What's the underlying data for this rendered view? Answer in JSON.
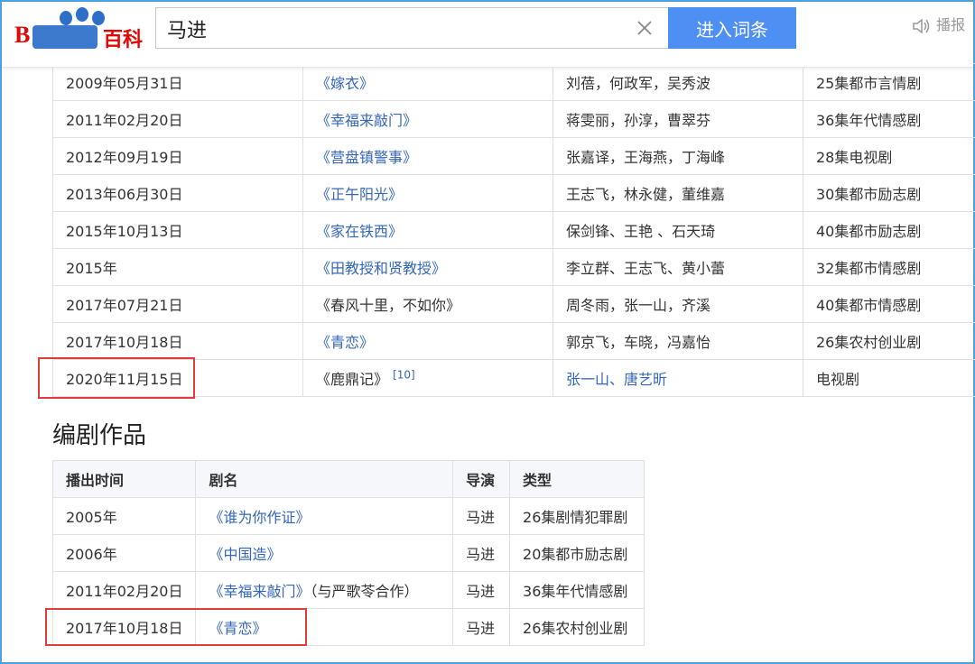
{
  "header": {
    "logo_text": "Bai百科",
    "search_value": "马进",
    "search_placeholder": "",
    "enter_button": "进入词条",
    "broadcast_label": "播报",
    "icons": [
      "clear-icon",
      "speaker-icon"
    ]
  },
  "acting_table": {
    "rows": [
      {
        "date": "2009年05月31日",
        "title": "《嫁衣》",
        "title_link": true,
        "cast": "刘蓓，何政军，吴秀波",
        "genre": "25集都市言情剧"
      },
      {
        "date": "2011年02月20日",
        "title": "《幸福来敲门》",
        "title_link": true,
        "cast": "蒋雯丽，孙淳，曹翠芬",
        "genre": "36集年代情感剧"
      },
      {
        "date": "2012年09月19日",
        "title": "《营盘镇警事》",
        "title_link": true,
        "cast": "张嘉译，王海燕，丁海峰",
        "genre": "28集电视剧"
      },
      {
        "date": "2013年06月30日",
        "title": "《正午阳光》",
        "title_link": true,
        "cast": "王志飞，林永健，董维嘉",
        "genre": "30集都市励志剧"
      },
      {
        "date": "2015年10月13日",
        "title": "《家在铁西》",
        "title_link": true,
        "cast": "保剑锋、王艳 、石天琦",
        "genre": "40集都市励志剧"
      },
      {
        "date": "2015年",
        "title": "《田教授和贤教授》",
        "title_link": true,
        "cast": "李立群、王志飞、黄小蕾",
        "genre": "32集都市情感剧"
      },
      {
        "date": "2017年07月21日",
        "title": "《春风十里，不如你》",
        "title_link": false,
        "cast": "周冬雨，张一山，齐溪",
        "genre": "40集都市情感剧"
      },
      {
        "date": "2017年10月18日",
        "title": "《青恋》",
        "title_link": true,
        "cast": "郭京飞，车晓，冯嘉怡",
        "genre": "26集农村创业剧"
      },
      {
        "date": "2020年11月15日",
        "title": "《鹿鼎记》",
        "title_link": false,
        "ref": "[10]",
        "cast": "张一山、唐艺昕",
        "cast_link": true,
        "genre": "电视剧"
      }
    ]
  },
  "writing_section": {
    "title": "编剧作品",
    "headers": [
      "播出时间",
      "剧名",
      "导演",
      "类型"
    ],
    "rows": [
      {
        "date": "2005年",
        "title": "《谁为你作证》",
        "note": "",
        "director": "马进",
        "genre": "26集剧情犯罪剧"
      },
      {
        "date": "2006年",
        "title": "《中国造》",
        "note": "",
        "director": "马进",
        "genre": "20集都市励志剧"
      },
      {
        "date": "2011年02月20日",
        "title": "《幸福来敲门》",
        "note": "（与严歌苓合作）",
        "director": "马进",
        "genre": "36集年代情感剧"
      },
      {
        "date": "2017年10月18日",
        "title": "《青恋》",
        "note": "",
        "director": "马进",
        "genre": "26集农村创业剧"
      }
    ]
  },
  "colors": {
    "link": "#3366bb",
    "button": "#4e8ff4",
    "highlight": "#e23b3b",
    "frame": "#4aa3df"
  }
}
